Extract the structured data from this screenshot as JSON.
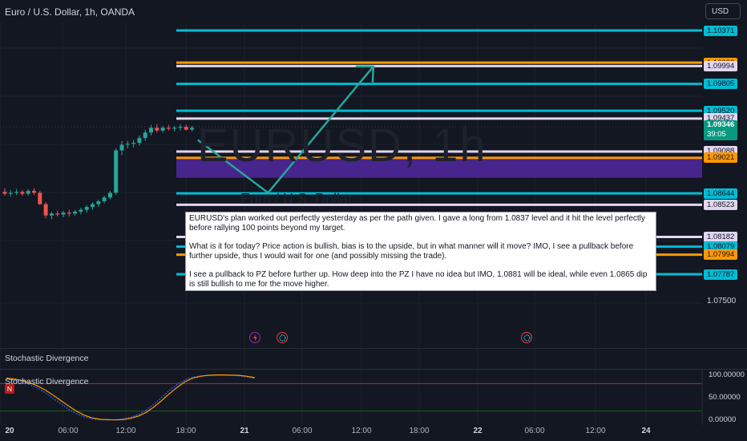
{
  "header": {
    "symbol_title": "Euro / U.S. Dollar, 1h, OANDA",
    "currency": "USD"
  },
  "watermark": {
    "symbol": "EURUSD, 1h",
    "subtitle": "Euro / U.S. Dollar"
  },
  "colors": {
    "background": "#131722",
    "cyan_level": "#00bcd4",
    "orange_level": "#ff9800",
    "white_level": "#e1d6f0",
    "zone": "#5b2bb5",
    "arrow": "#26a69a",
    "up_candle": "#26a69a",
    "down_candle": "#ef5350",
    "stoch_k": "#2962ff",
    "stoch_d": "#ff9800"
  },
  "chart_data": [
    {
      "type": "line",
      "title": "Euro / U.S. Dollar, 1h, OANDA",
      "price_axis": {
        "y_range": [
          1.0718,
          1.1065
        ],
        "plain_tick": "1.07500",
        "current_price": "1.09346",
        "countdown": "39:05"
      },
      "levels": [
        {
          "price": 1.10371,
          "label": "1.10371",
          "color": "cyan"
        },
        {
          "price": 1.1003,
          "label": "1.10030",
          "color": "orange"
        },
        {
          "price": 1.09994,
          "label": "1.09994",
          "color": "white"
        },
        {
          "price": 1.09805,
          "label": "1.09805",
          "color": "cyan"
        },
        {
          "price": 1.0952,
          "label": "1.09520",
          "color": "cyan"
        },
        {
          "price": 1.09437,
          "label": "1.09437",
          "color": "white"
        },
        {
          "price": 1.09088,
          "label": "1.09088",
          "color": "white"
        },
        {
          "price": 1.09021,
          "label": "1.09021",
          "color": "orange"
        },
        {
          "price": 1.08644,
          "label": "1.08644",
          "color": "cyan"
        },
        {
          "price": 1.08523,
          "label": "1.08523",
          "color": "white"
        },
        {
          "price": 1.08182,
          "label": "1.08182",
          "color": "white"
        },
        {
          "price": 1.08079,
          "label": "1.08079",
          "color": "cyan"
        },
        {
          "price": 1.07994,
          "label": "1.07994",
          "color": "orange"
        },
        {
          "price": 1.07787,
          "label": "1.07787",
          "color": "cyan"
        }
      ],
      "zone": {
        "from_price": 1.0902,
        "to_price": 1.0881
      },
      "time_axis": {
        "labels": [
          "20",
          "06:00",
          "12:00",
          "18:00",
          "21",
          "06:00",
          "12:00",
          "18:00",
          "22",
          "06:00",
          "12:00",
          "18:00",
          "24"
        ],
        "bold": [
          "20",
          "21",
          "22",
          "24"
        ]
      },
      "candles": [
        {
          "o": 1.0866,
          "h": 1.087,
          "l": 1.0862,
          "c": 1.0864
        },
        {
          "o": 1.0864,
          "h": 1.0868,
          "l": 1.0861,
          "c": 1.0865
        },
        {
          "o": 1.0865,
          "h": 1.0869,
          "l": 1.0863,
          "c": 1.0866
        },
        {
          "o": 1.0866,
          "h": 1.0868,
          "l": 1.0862,
          "c": 1.0864
        },
        {
          "o": 1.0864,
          "h": 1.0869,
          "l": 1.0862,
          "c": 1.0867
        },
        {
          "o": 1.0867,
          "h": 1.087,
          "l": 1.0863,
          "c": 1.0865
        },
        {
          "o": 1.0865,
          "h": 1.0867,
          "l": 1.0852,
          "c": 1.0853
        },
        {
          "o": 1.0853,
          "h": 1.0855,
          "l": 1.0838,
          "c": 1.0841
        },
        {
          "o": 1.0841,
          "h": 1.0845,
          "l": 1.0837,
          "c": 1.0843
        },
        {
          "o": 1.0843,
          "h": 1.0846,
          "l": 1.084,
          "c": 1.0842
        },
        {
          "o": 1.0842,
          "h": 1.0846,
          "l": 1.0839,
          "c": 1.0844
        },
        {
          "o": 1.0844,
          "h": 1.0847,
          "l": 1.084,
          "c": 1.0843
        },
        {
          "o": 1.0843,
          "h": 1.0847,
          "l": 1.0841,
          "c": 1.0845
        },
        {
          "o": 1.0845,
          "h": 1.0849,
          "l": 1.0842,
          "c": 1.0847
        },
        {
          "o": 1.0847,
          "h": 1.0852,
          "l": 1.0844,
          "c": 1.085
        },
        {
          "o": 1.085,
          "h": 1.0855,
          "l": 1.0847,
          "c": 1.0853
        },
        {
          "o": 1.0853,
          "h": 1.0858,
          "l": 1.085,
          "c": 1.0856
        },
        {
          "o": 1.0856,
          "h": 1.0862,
          "l": 1.0854,
          "c": 1.086
        },
        {
          "o": 1.086,
          "h": 1.0867,
          "l": 1.0858,
          "c": 1.0865
        },
        {
          "o": 1.0865,
          "h": 1.0912,
          "l": 1.0863,
          "c": 1.091
        },
        {
          "o": 1.091,
          "h": 1.092,
          "l": 1.0905,
          "c": 1.0916
        },
        {
          "o": 1.0916,
          "h": 1.092,
          "l": 1.0912,
          "c": 1.0917
        },
        {
          "o": 1.0917,
          "h": 1.0921,
          "l": 1.0913,
          "c": 1.0918
        },
        {
          "o": 1.0918,
          "h": 1.0926,
          "l": 1.0915,
          "c": 1.0923
        },
        {
          "o": 1.0923,
          "h": 1.0932,
          "l": 1.092,
          "c": 1.0929
        },
        {
          "o": 1.0929,
          "h": 1.0937,
          "l": 1.0926,
          "c": 1.0934
        },
        {
          "o": 1.0934,
          "h": 1.0938,
          "l": 1.0929,
          "c": 1.0931
        },
        {
          "o": 1.0931,
          "h": 1.0936,
          "l": 1.0929,
          "c": 1.0934
        },
        {
          "o": 1.0934,
          "h": 1.0937,
          "l": 1.0931,
          "c": 1.0933
        },
        {
          "o": 1.0933,
          "h": 1.0936,
          "l": 1.093,
          "c": 1.0934
        },
        {
          "o": 1.0934,
          "h": 1.0938,
          "l": 1.0931,
          "c": 1.0935
        },
        {
          "o": 1.0935,
          "h": 1.0937,
          "l": 1.0931,
          "c": 1.0932
        },
        {
          "o": 1.0932,
          "h": 1.0936,
          "l": 1.093,
          "c": 1.0934
        }
      ],
      "projection_path": [
        {
          "bar": 33,
          "price": 1.0921
        },
        {
          "bar": 45,
          "price": 1.0865
        },
        {
          "bar": 63,
          "price": 1.0999
        }
      ]
    },
    {
      "type": "line",
      "title": "Stochastic Divergence",
      "y_range": [
        0,
        100
      ],
      "tick_labels": [
        "100.00000",
        "50.00000",
        "0.00000"
      ],
      "series": [
        {
          "values": [
            90,
            88,
            84,
            78,
            70,
            60,
            48,
            36,
            24,
            14,
            7,
            3,
            1,
            0.5,
            1,
            3,
            6,
            12,
            22,
            35,
            50,
            65,
            78,
            88,
            94,
            97,
            98,
            98.5,
            98.5,
            98,
            97,
            95,
            91
          ]
        },
        {
          "values": [
            92,
            90,
            87,
            82,
            75,
            66,
            55,
            43,
            31,
            20,
            11,
            5,
            2,
            1,
            0.5,
            1,
            4,
            9,
            17,
            29,
            43,
            58,
            72,
            84,
            92,
            96,
            98,
            99,
            99,
            98.5,
            98,
            96,
            93
          ]
        }
      ]
    }
  ],
  "note": {
    "paragraphs": [
      "EURUSD's plan worked out perfectly yesterday as per the path given. I gave a long from 1.0837 level and it hit the level perfectly before rallying 100 points beyond my target.",
      "What is it for today? Price action is bullish, bias is to the upside, but in what manner will it move? IMO, I see a pullback before further upside, thus I would wait for one (and possibly missing the trade).",
      "I see a pullback to PZ before further up. How deep into the PZ I have no idea but IMO, 1.0881 will be ideal, while even 1.0865 dip is still bullish to me for the move higher."
    ]
  },
  "indicator_pane": {
    "title_1": "Stochastic Divergence",
    "title_2": "Stochastic Divergence",
    "badge": "N"
  },
  "events": {
    "icons": [
      "flash-event-icon",
      "earnings-icon",
      "earnings-icon"
    ]
  }
}
